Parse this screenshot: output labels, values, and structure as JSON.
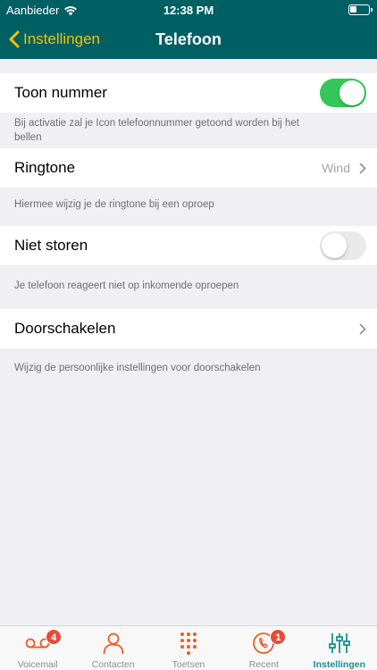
{
  "status": {
    "carrier": "Aanbieder",
    "time": "12:38 PM"
  },
  "nav": {
    "back_label": "Instellingen",
    "title": "Telefoon"
  },
  "settings": [
    {
      "label": "Toon nummer",
      "toggle": true,
      "description": "Bij activatie zal je Icon telefoonnummer getoond worden bij het bellen"
    },
    {
      "label": "Ringtone",
      "value": "Wind",
      "description": "Hiermee wijzig je de ringtone bij een oproep"
    },
    {
      "label": "Niet storen",
      "toggle": false,
      "description": "Je telefoon reageert niet op inkomende oproepen"
    },
    {
      "label": "Doorschakelen",
      "description": "Wijzig de persoonlijke instellingen voor doorschakelen"
    }
  ],
  "tabs": [
    {
      "label": "Voicemail",
      "icon": "voicemail-icon",
      "badge": "4"
    },
    {
      "label": "Contacten",
      "icon": "person-icon"
    },
    {
      "label": "Toetsen",
      "icon": "keypad-icon"
    },
    {
      "label": "Recent",
      "icon": "recent-calls-icon",
      "badge": "1"
    },
    {
      "label": "Instellingen",
      "icon": "sliders-icon",
      "active": true
    }
  ],
  "colors": {
    "header": "#005f63",
    "back": "#f2c200",
    "toggle_on": "#35c65a",
    "tab_icon": "#f05a22",
    "tab_active": "#1b8f93",
    "badge": "#e84a3a"
  }
}
